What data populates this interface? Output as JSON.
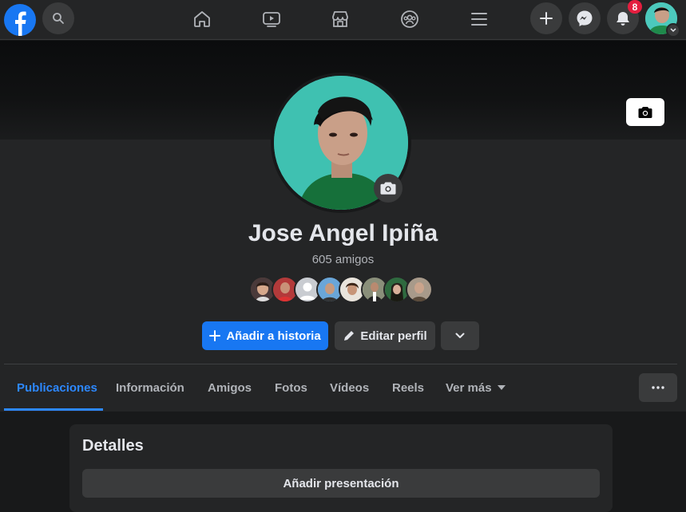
{
  "topbar": {
    "icons": {
      "logo": "facebook-logo",
      "search": "search-icon",
      "home": "home-icon",
      "watch": "video-icon",
      "marketplace": "marketplace-icon",
      "groups": "groups-icon",
      "menu": "menu-icon",
      "create": "plus-icon",
      "messenger": "messenger-icon",
      "notifications": "bell-icon"
    },
    "notification_count": "8"
  },
  "profile": {
    "name": "Jose Angel Ipiña",
    "friends_count": "605 amigos"
  },
  "actions": {
    "add_story": "Añadir a historia",
    "edit_profile": "Editar perfil"
  },
  "tabs": [
    {
      "label": "Publicaciones",
      "active": true
    },
    {
      "label": "Información"
    },
    {
      "label": "Amigos"
    },
    {
      "label": "Fotos"
    },
    {
      "label": "Vídeos"
    },
    {
      "label": "Reels"
    },
    {
      "label": "Ver más"
    }
  ],
  "details": {
    "title": "Detalles",
    "add_bio": "Añadir presentación"
  },
  "colors": {
    "accent": "#1877f2",
    "background": "#18191a",
    "surface": "#242526",
    "button": "#3a3b3c",
    "badge": "#e41e3f"
  }
}
